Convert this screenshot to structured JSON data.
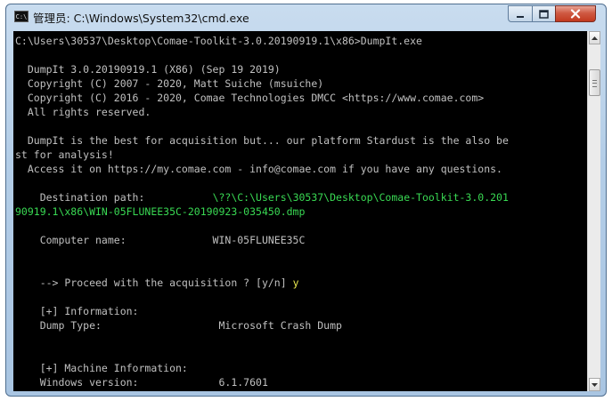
{
  "window": {
    "title": "管理员: C:\\Windows\\System32\\cmd.exe",
    "icon_label": "C:\\"
  },
  "console": {
    "lines": [
      [
        {
          "t": "C:\\Users\\30537\\Desktop\\Comae-Toolkit-3.0.20190919.1\\x86>DumpIt.exe"
        }
      ],
      [
        {
          "t": ""
        }
      ],
      [
        {
          "t": "  DumpIt 3.0.20190919.1 (X86) (Sep 19 2019)"
        }
      ],
      [
        {
          "t": "  Copyright (C) 2007 - 2020, Matt Suiche (msuiche)"
        }
      ],
      [
        {
          "t": "  Copyright (C) 2016 - 2020, Comae Technologies DMCC <https://www.comae.com>"
        }
      ],
      [
        {
          "t": "  All rights reserved."
        }
      ],
      [
        {
          "t": ""
        }
      ],
      [
        {
          "t": "  DumpIt is the best for acquisition but... our platform Stardust is the also be"
        }
      ],
      [
        {
          "t": "st for analysis!"
        }
      ],
      [
        {
          "t": "  Access it on https://my.comae.com - info@comae.com if you have any questions."
        }
      ],
      [
        {
          "t": ""
        }
      ],
      [
        {
          "t": "    Destination path:           "
        },
        {
          "t": "\\??\\C:\\Users\\30537\\Desktop\\Comae-Toolkit-3.0.201",
          "c": "g"
        }
      ],
      [
        {
          "t": "90919.1\\x86\\WIN-05FLUNEE35C-20190923-035450.dmp",
          "c": "g"
        }
      ],
      [
        {
          "t": ""
        }
      ],
      [
        {
          "t": "    Computer name:              WIN-05FLUNEE35C"
        }
      ],
      [
        {
          "t": ""
        }
      ],
      [
        {
          "t": ""
        }
      ],
      [
        {
          "t": "    --> Proceed with the acquisition ? [y/n] "
        },
        {
          "t": "y",
          "c": "y"
        }
      ],
      [
        {
          "t": ""
        }
      ],
      [
        {
          "t": "    [+] Information:"
        }
      ],
      [
        {
          "t": "    Dump Type:                   Microsoft Crash Dump"
        }
      ],
      [
        {
          "t": ""
        }
      ],
      [
        {
          "t": ""
        }
      ],
      [
        {
          "t": "    [+] Machine Information:"
        }
      ],
      [
        {
          "t": "    Windows version:             6.1.7601"
        }
      ]
    ]
  }
}
